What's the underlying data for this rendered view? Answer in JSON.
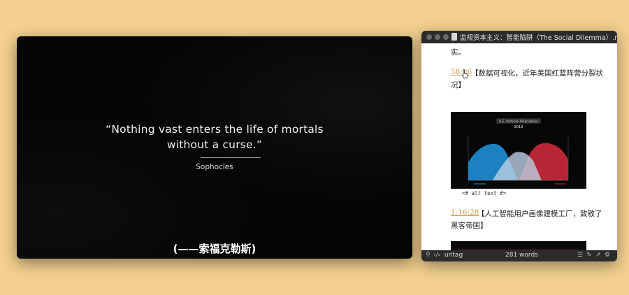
{
  "video": {
    "quote_line1": "“Nothing vast enters the life of mortals",
    "quote_line2": "without a curse.”",
    "author": "Sophocles",
    "subtitle": "(——索福克勒斯)"
  },
  "editor": {
    "title": "监视资本主义：智能陷阱（The Social Dilemma）.md",
    "lines": {
      "l1": "实。",
      "ts1": "58:06",
      "l2": "【数据可视化，近年美国红蓝阵营分裂状",
      "l3": "况】",
      "alt_text": "<# alt text #>",
      "ts2": "1:16:28",
      "l4": "【人工智能用户画像建模工厂，致敬了",
      "l5": "黑客帝国】"
    },
    "chart": {
      "title": "U.S. Partisan Polarization",
      "year": "2013",
      "colors": {
        "blue": "#1f8fd6",
        "red": "#c8283a",
        "center": "#bcd0e4"
      }
    },
    "statusbar": {
      "tag_label": "untag",
      "word_count": "281 words"
    },
    "icons": [
      "pin-icon",
      "code-icon",
      "list-icon",
      "pen-icon",
      "share-icon",
      "gear-icon"
    ]
  }
}
